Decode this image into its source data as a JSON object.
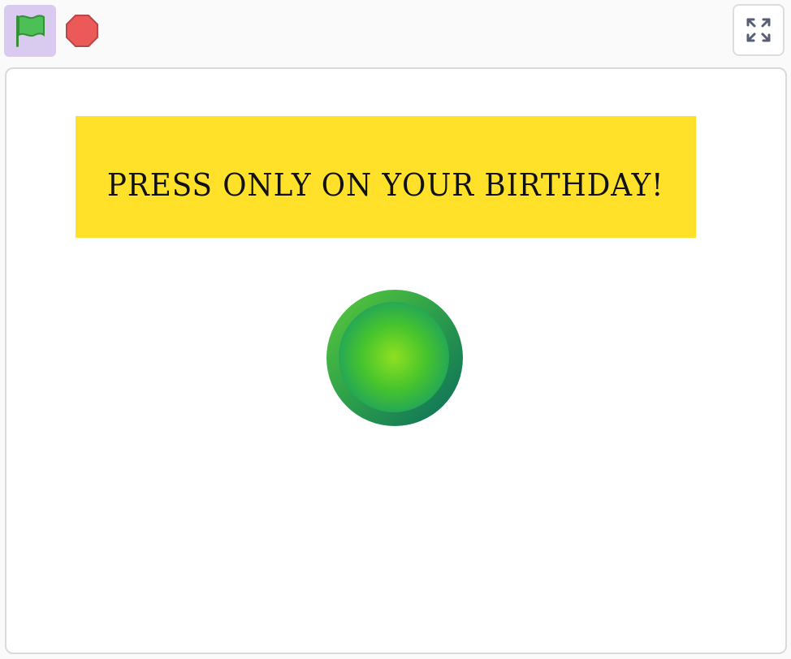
{
  "toolbar": {
    "green_flag_icon": "green-flag-icon",
    "stop_icon": "stop-sign-icon",
    "fullscreen_icon": "fullscreen-toggle-icon"
  },
  "stage": {
    "banner_text": "PRESS ONLY ON YOUR BIRTHDAY!",
    "banner_color": "#ffe12a",
    "button_color": "#48c52c"
  }
}
